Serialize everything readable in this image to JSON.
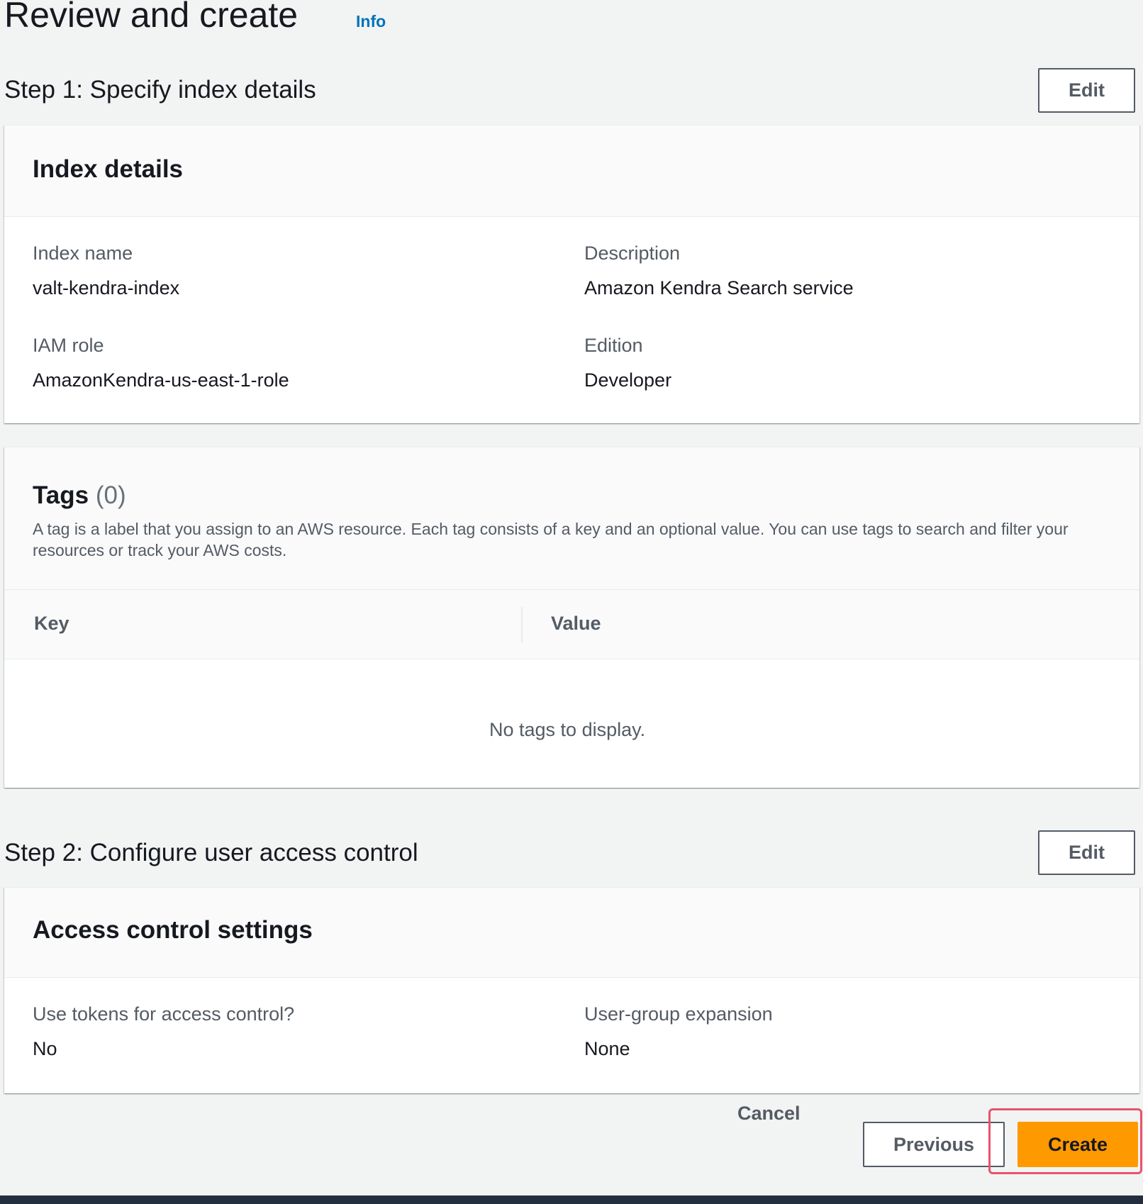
{
  "page": {
    "title": "Review and create",
    "info_link": "Info"
  },
  "step1": {
    "title": "Step 1: Specify index details",
    "edit_label": "Edit",
    "index_details": {
      "title": "Index details",
      "fields": [
        {
          "label": "Index name",
          "value": "valt-kendra-index"
        },
        {
          "label": "Description",
          "value": "Amazon Kendra Search service"
        },
        {
          "label": "IAM role",
          "value": "AmazonKendra-us-east-1-role"
        },
        {
          "label": "Edition",
          "value": "Developer"
        }
      ]
    },
    "tags": {
      "title": "Tags",
      "count": "(0)",
      "description": "A tag is a label that you assign to an AWS resource. Each tag consists of a key and an optional value. You can use tags to search and filter your resources or track your AWS costs.",
      "columns": [
        "Key",
        "Value"
      ],
      "empty_message": "No tags to display."
    }
  },
  "step2": {
    "title": "Step 2: Configure user access control",
    "edit_label": "Edit",
    "access_control": {
      "title": "Access control settings",
      "fields": [
        {
          "label": "Use tokens for access control?",
          "value": "No"
        },
        {
          "label": "User-group expansion",
          "value": "None"
        }
      ]
    }
  },
  "footer": {
    "cancel_label": "Cancel",
    "previous_label": "Previous",
    "create_label": "Create"
  },
  "colors": {
    "link": "#0073bb",
    "primary_button": "#ff9900",
    "focus_ring": "#e8536c",
    "page_background": "#f2f3f3"
  }
}
